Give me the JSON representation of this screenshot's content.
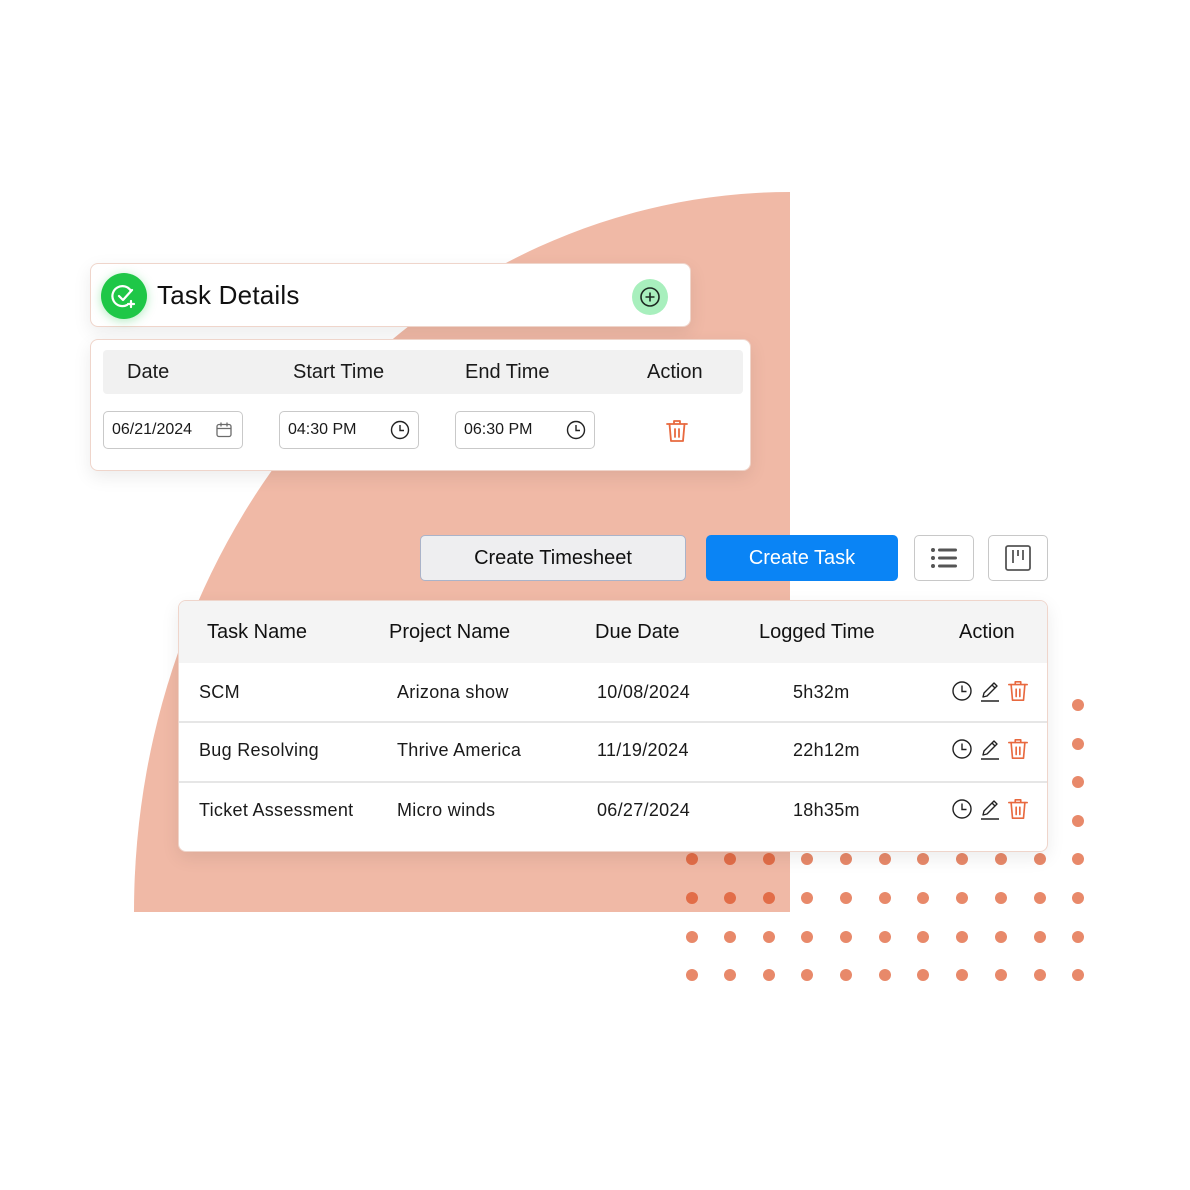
{
  "colors": {
    "accent_bg": "#f0b9a6",
    "dot": "#e8896a",
    "primary_button": "#0a84f5",
    "success": "#1ec747",
    "success_light": "#a8efbd",
    "danger": "#e8693f"
  },
  "task_details": {
    "title": "Task Details",
    "badge_icon": "check-circle-plus-icon",
    "add_icon": "plus-circle-icon",
    "columns": [
      "Date",
      "Start Time",
      "End Time",
      "Action"
    ],
    "entry": {
      "date": "06/21/2024",
      "start_time": "04:30 PM",
      "end_time": "06:30 PM",
      "date_icon": "calendar-icon",
      "time_icon": "clock-icon",
      "action_icon": "trash-icon"
    }
  },
  "toolbar": {
    "create_timesheet_label": "Create Timesheet",
    "create_task_label": "Create Task",
    "list_view_icon": "list-icon",
    "board_view_icon": "board-icon"
  },
  "tasks_table": {
    "columns": [
      "Task Name",
      "Project Name",
      "Due Date",
      "Logged Time",
      "Action"
    ],
    "rows": [
      {
        "task_name": "SCM",
        "project_name": "Arizona show",
        "due_date": "10/08/2024",
        "logged_time": "5h32m"
      },
      {
        "task_name": "Bug Resolving",
        "project_name": "Thrive America",
        "due_date": "11/19/2024",
        "logged_time": "22h12m"
      },
      {
        "task_name": "Ticket Assessment",
        "project_name": "Micro winds",
        "due_date": "06/27/2024",
        "logged_time": "18h35m"
      }
    ],
    "row_action_icons": [
      "clock-icon",
      "pencil-icon",
      "trash-icon"
    ]
  }
}
